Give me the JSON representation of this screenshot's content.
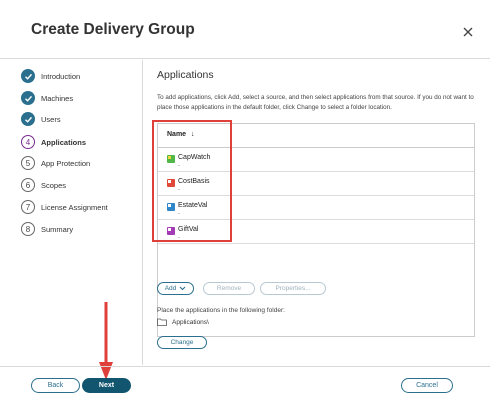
{
  "dialog": {
    "title": "Create Delivery Group"
  },
  "steps": [
    {
      "label": "Introduction",
      "state": "done"
    },
    {
      "label": "Machines",
      "state": "done"
    },
    {
      "label": "Users",
      "state": "done"
    },
    {
      "number": "4",
      "label": "Applications",
      "state": "current"
    },
    {
      "number": "5",
      "label": "App Protection",
      "state": "todo"
    },
    {
      "number": "6",
      "label": "Scopes",
      "state": "todo"
    },
    {
      "number": "7",
      "label": "License Assignment",
      "state": "todo"
    },
    {
      "number": "8",
      "label": "Summary",
      "state": "todo"
    }
  ],
  "main": {
    "title": "Applications",
    "description": "To add applications, click Add, select a source, and then select applications from that source. If you do not want to place those applications in the default folder, click Change to select a folder location.",
    "column_header": "Name",
    "sort_arrow": "↓",
    "apps": [
      {
        "name": "CapWatch",
        "sub": "-",
        "color": "#4fb848"
      },
      {
        "name": "CostBasis",
        "sub": "-",
        "color": "#e0483a"
      },
      {
        "name": "EstateVal",
        "sub": "-",
        "color": "#2f86c8"
      },
      {
        "name": "GiftVal",
        "sub": "-",
        "color": "#a23bb5"
      }
    ],
    "add_label": "Add",
    "remove_label": "Remove",
    "properties_label": "Properties...",
    "folder_label": "Place the applications in the following folder:",
    "folder_path": "Applications\\",
    "change_label": "Change"
  },
  "footer": {
    "back": "Back",
    "next": "Next",
    "cancel": "Cancel"
  },
  "colors": {
    "accent": "#2b6f8f",
    "primary": "#11556f",
    "highlight": "#e0403a"
  }
}
